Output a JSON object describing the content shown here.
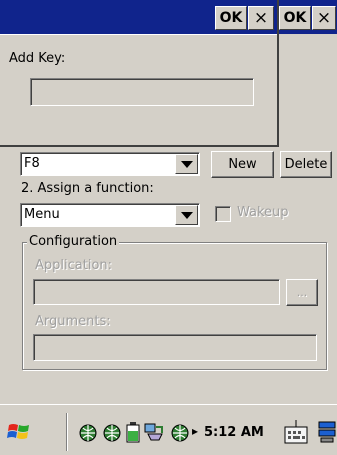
{
  "back_window": {
    "ok_label": "OK",
    "close_label": "×",
    "key_combo_value": "F8",
    "new_label": "New",
    "delete_label": "Delete",
    "assign_label": "2. Assign a function:",
    "function_combo_value": "Menu",
    "wakeup_label": "Wakeup",
    "configuration_label": "Configuration",
    "application_label": "Application:",
    "application_value": "",
    "browse_label": "...",
    "arguments_label": "Arguments:",
    "arguments_value": ""
  },
  "dialog": {
    "ok_label": "OK",
    "close_label": "×",
    "add_key_label": "Add Key:",
    "add_key_value": ""
  },
  "taskbar": {
    "clock": "5:12 AM",
    "arrow": "▸"
  },
  "colors": {
    "titlebar": "#10248c",
    "face": "#d4d0c8"
  }
}
